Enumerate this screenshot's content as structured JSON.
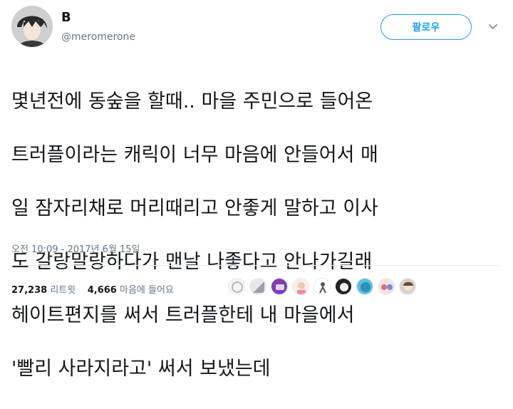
{
  "tweet": {
    "display_name": "B",
    "handle": "@meromerone",
    "follow_label": "팔로우",
    "text_lines": [
      "몇년전에 동숲을 할때.. 마을 주민으로 들어온",
      "트러플이라는 캐릭이 너무 마음에 안들어서 매",
      "일 잠자리채로 머리때리고 안좋게 말하고 이사",
      "도 갈랑말랑하다가 맨날 나좋다고 안나가길래",
      "헤이트편지를 써서 트러플한테 내 마을에서",
      "'빨리 사라지라고' 써서 보냈는데"
    ],
    "timestamp": "오전 10:09 - 2017년 6월 15일"
  },
  "stats": {
    "retweets_count": "27,238",
    "retweets_label": "리트윗",
    "likes_count": "4,666",
    "likes_label": "마음에 들어요"
  },
  "colors": {
    "accent": "#1da1f2",
    "text": "#14171a",
    "secondary": "#657786",
    "divider": "#e6ecf0"
  },
  "icons": {
    "caret": "chevron-down-icon"
  }
}
